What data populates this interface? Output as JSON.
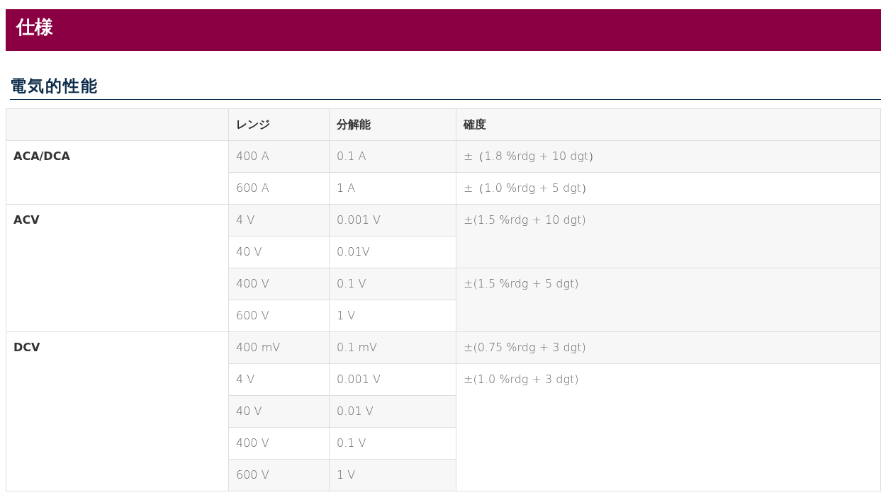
{
  "page_title": "仕様",
  "section_title": "電気的性能",
  "table": {
    "columns": [
      "レンジ",
      "分解能",
      "確度"
    ],
    "groups": [
      {
        "label": "ACA/DCA",
        "rows": [
          {
            "range": "400 A",
            "resolution": "0.1 A",
            "accuracy": "±（1.8 %rdg + 10 dgt）"
          },
          {
            "range": "600 A",
            "resolution": "1 A",
            "accuracy": "±（1.0 %rdg + 5 dgt）"
          }
        ]
      },
      {
        "label": "ACV",
        "rows": [
          {
            "range": "4 V",
            "resolution": "0.001 V",
            "accuracy": "±(1.5 %rdg + 10 dgt)"
          },
          {
            "range": "40 V",
            "resolution": "0.01V"
          },
          {
            "range": "400 V",
            "resolution": "0.1 V",
            "accuracy": "±(1.5 %rdg + 5 dgt)"
          },
          {
            "range": "600 V",
            "resolution": "1 V"
          }
        ]
      },
      {
        "label": "DCV",
        "rows": [
          {
            "range": "400 mV",
            "resolution": "0.1 mV",
            "accuracy": "±(0.75 %rdg + 3 dgt)"
          },
          {
            "range": "4 V",
            "resolution": "0.001 V",
            "accuracy": "±(1.0 %rdg + 3 dgt)"
          },
          {
            "range": "40 V",
            "resolution": "0.01 V"
          },
          {
            "range": "400 V",
            "resolution": "0.1 V"
          },
          {
            "range": "600 V",
            "resolution": "1 V"
          }
        ]
      }
    ]
  }
}
